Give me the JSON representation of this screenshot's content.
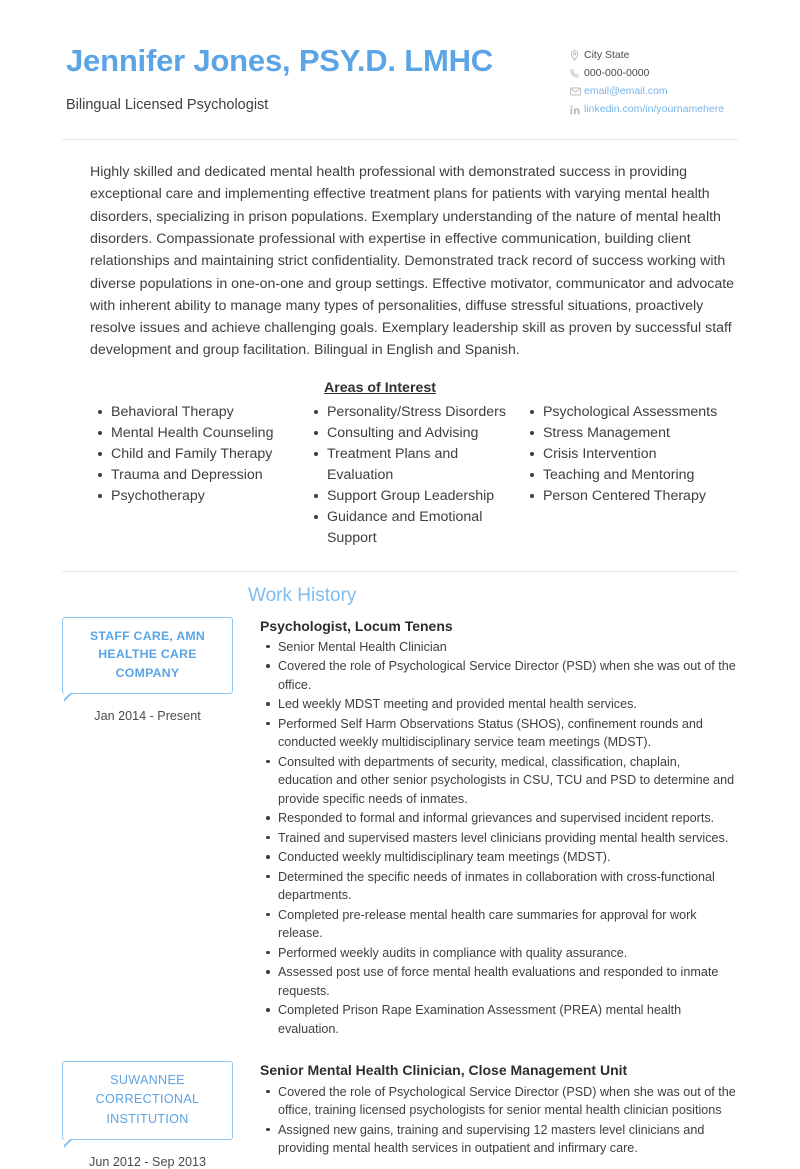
{
  "header": {
    "full_name": "Jennifer Jones, PSY.D. LMHC",
    "job_title": "Bilingual Licensed Psychologist",
    "contacts": [
      {
        "icon": "location-pin-icon",
        "text": "City State",
        "is_link": false
      },
      {
        "icon": "phone-icon",
        "text": "000-000-0000",
        "is_link": false
      },
      {
        "icon": "envelope-icon",
        "text": "email@email.com",
        "is_link": true
      },
      {
        "icon": "linkedin-icon",
        "text": "linkedin.com/in/yournamehere",
        "is_link": true
      }
    ]
  },
  "summary": {
    "text": "Highly skilled and dedicated mental health professional with demonstrated success in providing exceptional care and implementing effective treatment plans for patients with varying mental health disorders, specializing in prison populations. Exemplary understanding of the nature of mental health disorders. Compassionate professional with expertise in effective communication, building client relationships and maintaining strict confidentiality. Demonstrated track record of success working with diverse populations in one-on-one and group settings. Effective motivator, communicator and advocate with inherent ability to manage many types of personalities, diffuse stressful situations, proactively resolve issues and achieve challenging goals. Exemplary leadership skill as proven by successful staff development and group facilitation. Bilingual in English and Spanish."
  },
  "areas_of_interest": {
    "title": "Areas of Interest",
    "columns": [
      [
        "Behavioral Therapy",
        "Mental Health Counseling",
        "Child and Family Therapy",
        "Trauma and Depression",
        "Psychotherapy"
      ],
      [
        "Personality/Stress Disorders",
        "Consulting and Advising",
        "Treatment Plans and Evaluation",
        "Support Group Leadership",
        "Guidance and Emotional Support"
      ],
      [
        "Psychological Assessments",
        "Stress Management",
        "Crisis Intervention",
        "Teaching and Mentoring",
        "Person Centered Therapy"
      ]
    ]
  },
  "work_history": {
    "heading": "Work History",
    "jobs": [
      {
        "company": "STAFF CARE, AMN HEALTHE CARE COMPANY",
        "dates": "Jan 2014 - Present",
        "role": "Psychologist, Locum Tenens",
        "bullets": [
          "Senior Mental Health Clinician",
          "Covered the role of Psychological Service Director (PSD) when she was out of the office.",
          "Led weekly MDST meeting and provided mental health services.",
          "Performed Self Harm Observations Status (SHOS), confinement rounds and conducted weekly multidisciplinary service team meetings (MDST).",
          "Consulted with departments of security, medical, classification, chaplain, education and other senior psychologists in CSU, TCU and PSD to determine and provide specific needs of inmates.",
          "Responded to formal and informal grievances and supervised incident reports.",
          "Trained and supervised masters level clinicians providing mental health services.",
          "Conducted weekly multidisciplinary team meetings (MDST).",
          "Determined the specific needs of inmates in collaboration with cross-functional departments.",
          "Completed pre-release mental health care summaries for approval for work release.",
          "Performed weekly audits in compliance with quality assurance.",
          "Assessed post use of force mental health evaluations and responded to inmate requests.",
          "Completed Prison Rape Examination Assessment (PREA) mental health evaluation."
        ]
      },
      {
        "company": "SUWANNEE CORRECTIONAL INSTITUTION",
        "dates": "Jun 2012 - Sep 2013",
        "role": "Senior Mental Health Clinician, Close Management Unit",
        "bullets": [
          "Covered the role of Psychological Service Director (PSD) when she was out of the office, training licensed psychologists for senior mental health clinician positions",
          "Assigned new gains, training and supervising 12 masters level clinicians and providing mental health services in outpatient and infirmary care."
        ]
      }
    ]
  },
  "colors": {
    "name_blue": "#5ba4e5",
    "heading_blue": "#7fbdf0",
    "box_border_blue": "#8ec6f0",
    "link_blue": "#79b4ea",
    "divider_gray": "#e8e8e8",
    "body_text": "#3f3f3f"
  }
}
